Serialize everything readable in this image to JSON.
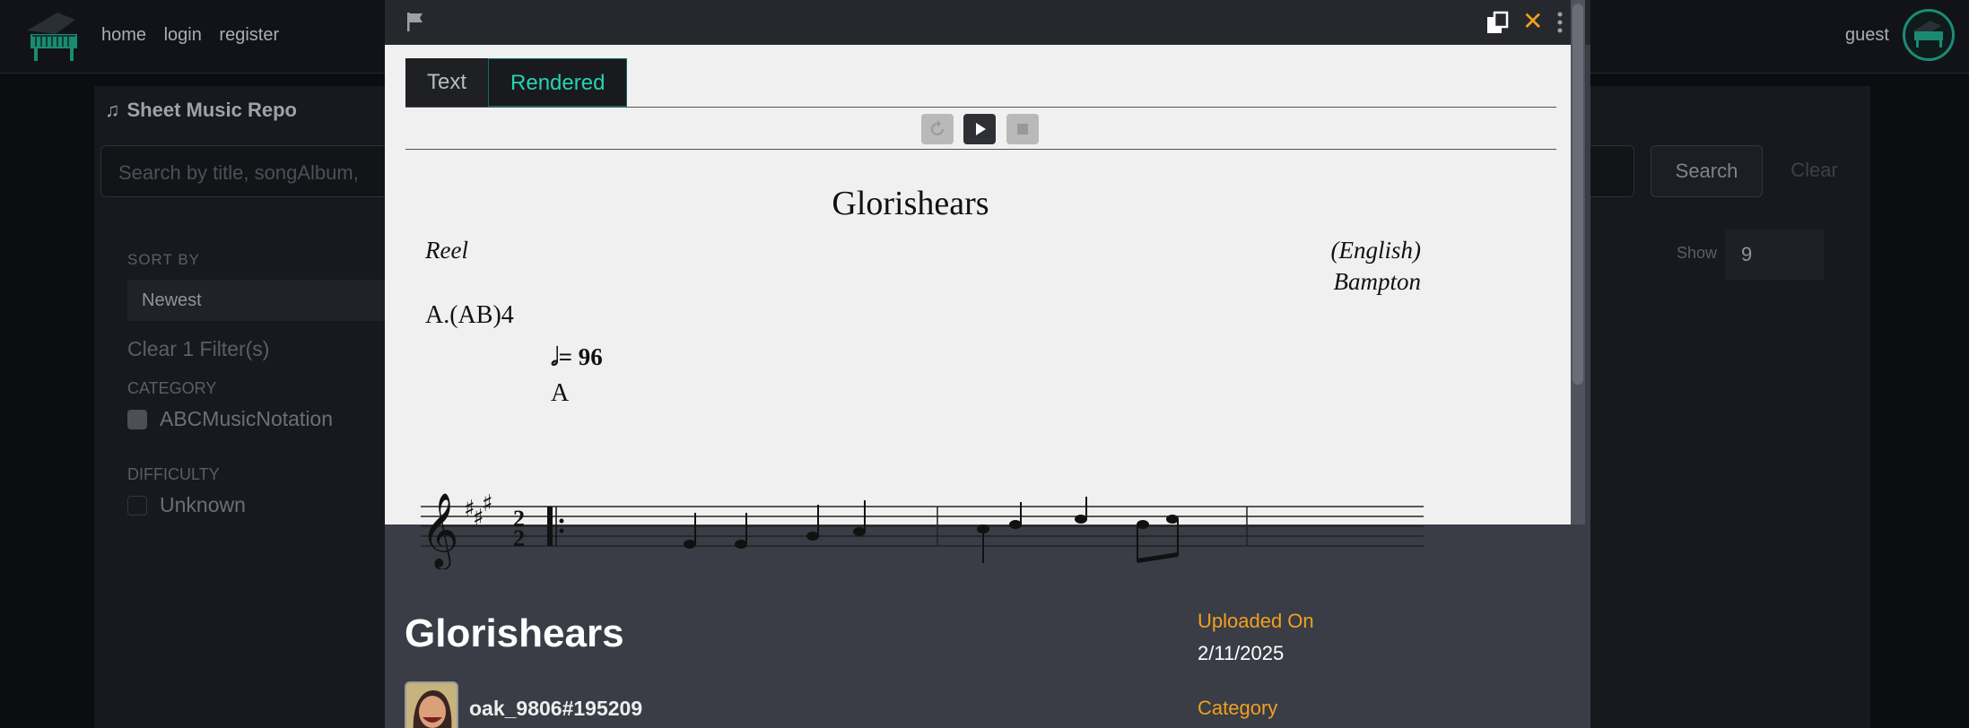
{
  "nav": {
    "home": "home",
    "login": "login",
    "register": "register",
    "user": "guest"
  },
  "repo": {
    "title": "Sheet Music Repo",
    "search_placeholder": "Search by title, songAlbum,",
    "search_label": "Search",
    "clear_label": "Clear",
    "sort_by_label": "SORT BY",
    "sort_value": "Newest",
    "clear_filters": "Clear 1 Filter(s)",
    "category_label": "CATEGORY",
    "category_option": "ABCMusicNotation",
    "difficulty_label": "DIFFICULTY",
    "difficulty_option": "Unknown",
    "show_label": "Show",
    "show_value": "9"
  },
  "modal": {
    "tabs": [
      "Text",
      "Rendered"
    ],
    "active_tab": "Rendered",
    "score": {
      "title": "Glorishears",
      "rhythm": "Reel",
      "origin": "(English)",
      "composer": "Bampton",
      "parts": "A.(AB)4",
      "tempo": "= 96",
      "part_label": "A",
      "time_signature_top": "2",
      "time_signature_bottom": "2"
    },
    "info": {
      "song_title": "Glorishears",
      "uploader": "oak_9806#195209",
      "uploaded_on_label": "Uploaded On",
      "uploaded_on_value": "2/11/2025",
      "category_label": "Category"
    }
  },
  "colors": {
    "accent_orange": "#f0a020",
    "accent_teal": "#27d3b0"
  }
}
